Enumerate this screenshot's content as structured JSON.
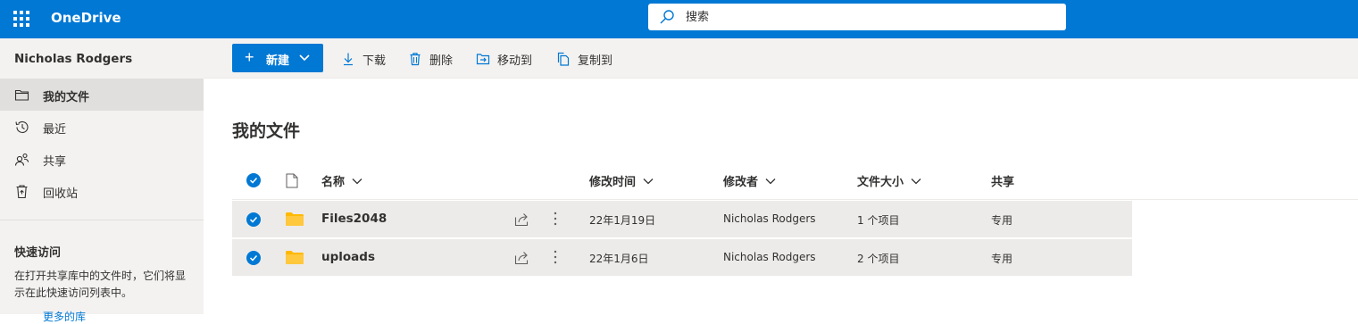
{
  "app": {
    "title": "OneDrive"
  },
  "search": {
    "placeholder": "搜索"
  },
  "sidebar": {
    "username": "Nicholas Rodgers",
    "items": [
      {
        "label": "我的文件",
        "icon": "folder-icon",
        "active": true
      },
      {
        "label": "最近",
        "icon": "history-icon",
        "active": false
      },
      {
        "label": "共享",
        "icon": "people-icon",
        "active": false
      },
      {
        "label": "回收站",
        "icon": "recycle-bin-icon",
        "active": false
      }
    ],
    "quick_access": {
      "title": "快速访问",
      "description": "在打开共享库中的文件时，它们将显示在此快速访问列表中。",
      "more": "更多的库"
    }
  },
  "toolbar": {
    "new_label": "新建",
    "download_label": "下载",
    "delete_label": "删除",
    "move_label": "移动到",
    "copy_label": "复制到"
  },
  "main": {
    "title": "我的文件",
    "columns": {
      "name": "名称",
      "modified": "修改时间",
      "modified_by": "修改者",
      "size": "文件大小",
      "sharing": "共享"
    },
    "rows": [
      {
        "name": "Files2048",
        "modified": "22年1月19日",
        "modified_by": "Nicholas Rodgers",
        "size": "1 个项目",
        "sharing": "专用"
      },
      {
        "name": "uploads",
        "modified": "22年1月6日",
        "modified_by": "Nicholas Rodgers",
        "size": "2 个项目",
        "sharing": "专用"
      }
    ]
  },
  "colors": {
    "brand": "#0078d4",
    "sidebar_bg": "#f3f2f1",
    "row_selected": "#edebe9",
    "folder": "#ffb900"
  }
}
